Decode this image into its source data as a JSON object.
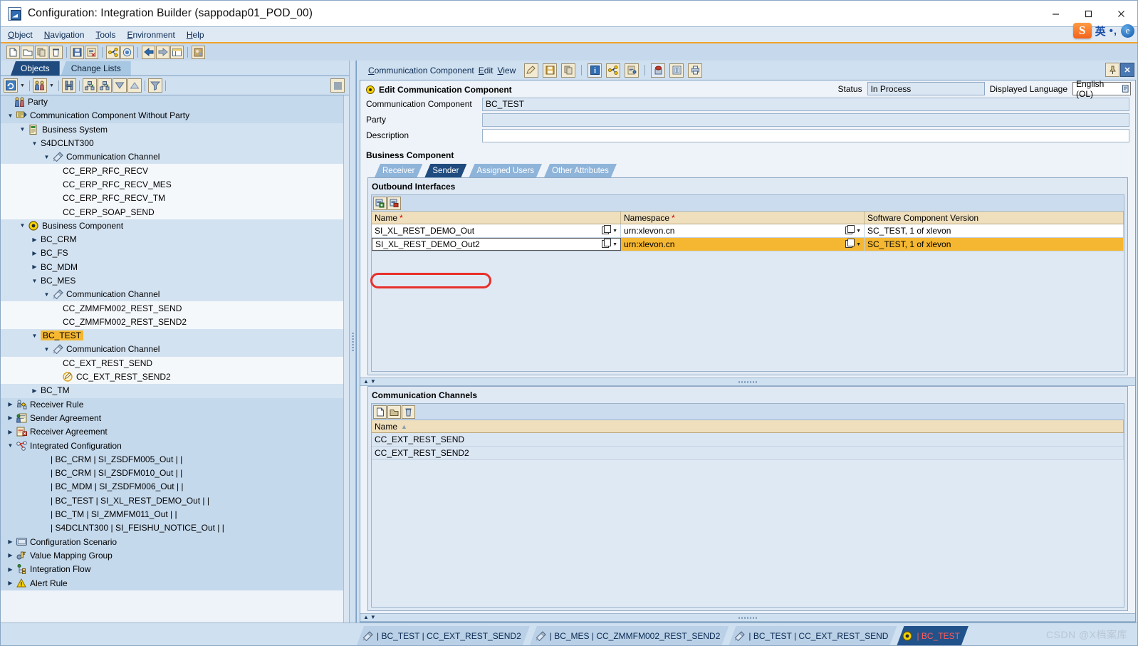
{
  "window": {
    "title": "Configuration: Integration Builder (sappodap01_POD_00)",
    "app_icon": "integration-builder-icon",
    "minimize": "—",
    "maximize": "☐",
    "close": "✕"
  },
  "menubar": {
    "items": [
      {
        "label": "Object",
        "accel": "O"
      },
      {
        "label": "Navigation",
        "accel": "N"
      },
      {
        "label": "Tools",
        "accel": "T"
      },
      {
        "label": "Environment",
        "accel": "E"
      },
      {
        "label": "Help",
        "accel": "H"
      }
    ]
  },
  "ime": {
    "logo": "S",
    "mode": "英",
    "punct": "•,",
    "browser": "e"
  },
  "app_toolbar": {
    "buttons": [
      "new-icon",
      "open-icon",
      "copy-icon",
      "delete-icon",
      "save-icon",
      "activate-icon",
      "where-used-icon",
      "check-icon",
      "back-icon",
      "forward-icon",
      "list-icon",
      "theme-icon"
    ]
  },
  "left_pane": {
    "tabs": [
      {
        "label": "Objects",
        "active": true
      },
      {
        "label": "Change Lists",
        "active": false
      }
    ],
    "toolbar_buttons": [
      "refresh-icon",
      "refresh-dropdown-icon",
      "find-objects-icon",
      "find-objects-dropdown-icon",
      "search-icon",
      "expand-all-icon",
      "collapse-all-icon",
      "move-down-icon",
      "move-up-icon",
      "filter-icon",
      "stop-icon"
    ],
    "tree": [
      {
        "depth": 0,
        "label": "Party",
        "icon": "party-icon",
        "arrow": "none",
        "band": 0
      },
      {
        "depth": 0,
        "label": "Communication Component Without Party",
        "icon": "comm-component-noparty-icon",
        "arrow": "down",
        "band": 0
      },
      {
        "depth": 1,
        "label": "Business System",
        "icon": "business-system-icon",
        "arrow": "down",
        "band": 1
      },
      {
        "depth": 2,
        "label": "S4DCLNT300",
        "icon": "none",
        "arrow": "down",
        "band": 1
      },
      {
        "depth": 3,
        "label": "Communication Channel",
        "icon": "comm-channel-icon",
        "arrow": "down",
        "band": 1
      },
      {
        "depth": 4,
        "label": "CC_ERP_RFC_RECV",
        "icon": "none",
        "arrow": "none",
        "band": 3
      },
      {
        "depth": 4,
        "label": "CC_ERP_RFC_RECV_MES",
        "icon": "none",
        "arrow": "none",
        "band": 3
      },
      {
        "depth": 4,
        "label": "CC_ERP_RFC_RECV_TM",
        "icon": "none",
        "arrow": "none",
        "band": 3
      },
      {
        "depth": 4,
        "label": "CC_ERP_SOAP_SEND",
        "icon": "none",
        "arrow": "none",
        "band": 3
      },
      {
        "depth": 1,
        "label": "Business Component",
        "icon": "business-component-icon",
        "arrow": "down",
        "band": 1
      },
      {
        "depth": 2,
        "label": "BC_CRM",
        "icon": "none",
        "arrow": "right",
        "band": 1
      },
      {
        "depth": 2,
        "label": "BC_FS",
        "icon": "none",
        "arrow": "right",
        "band": 1
      },
      {
        "depth": 2,
        "label": "BC_MDM",
        "icon": "none",
        "arrow": "right",
        "band": 1
      },
      {
        "depth": 2,
        "label": "BC_MES",
        "icon": "none",
        "arrow": "down",
        "band": 1
      },
      {
        "depth": 3,
        "label": "Communication Channel",
        "icon": "comm-channel-icon",
        "arrow": "down",
        "band": 1
      },
      {
        "depth": 4,
        "label": "CC_ZMMFM002_REST_SEND",
        "icon": "none",
        "arrow": "none",
        "band": 3
      },
      {
        "depth": 4,
        "label": "CC_ZMMFM002_REST_SEND2",
        "icon": "none",
        "arrow": "none",
        "band": 3
      },
      {
        "depth": 2,
        "label": "BC_TEST",
        "icon": "none",
        "arrow": "down",
        "band": 1,
        "highlight": true
      },
      {
        "depth": 3,
        "label": "Communication Channel",
        "icon": "comm-channel-icon",
        "arrow": "down",
        "band": 1
      },
      {
        "depth": 4,
        "label": "CC_EXT_REST_SEND",
        "icon": "none",
        "arrow": "none",
        "band": 3
      },
      {
        "depth": 4,
        "label": "CC_EXT_REST_SEND2",
        "icon": "edit-object-icon",
        "arrow": "none",
        "band": 3
      },
      {
        "depth": 2,
        "label": "BC_TM",
        "icon": "none",
        "arrow": "right",
        "band": 1
      },
      {
        "depth": 0,
        "label": "Receiver Rule",
        "icon": "receiver-rule-icon",
        "arrow": "right",
        "band": 0
      },
      {
        "depth": 0,
        "label": "Sender Agreement",
        "icon": "sender-agreement-icon",
        "arrow": "right",
        "band": 0
      },
      {
        "depth": 0,
        "label": "Receiver Agreement",
        "icon": "receiver-agreement-icon",
        "arrow": "right",
        "band": 0
      },
      {
        "depth": 0,
        "label": "Integrated Configuration",
        "icon": "integrated-config-icon",
        "arrow": "down",
        "band": 0
      },
      {
        "depth": 3,
        "label": "| BC_CRM | SI_ZSDFM005_Out |  |",
        "icon": "none",
        "arrow": "none",
        "band": 0
      },
      {
        "depth": 3,
        "label": "| BC_CRM | SI_ZSDFM010_Out |  |",
        "icon": "none",
        "arrow": "none",
        "band": 0
      },
      {
        "depth": 3,
        "label": "| BC_MDM | SI_ZSDFM006_Out |  |",
        "icon": "none",
        "arrow": "none",
        "band": 0
      },
      {
        "depth": 3,
        "label": "| BC_TEST | SI_XL_REST_DEMO_Out |  |",
        "icon": "none",
        "arrow": "none",
        "band": 0
      },
      {
        "depth": 3,
        "label": "| BC_TM | SI_ZMMFM011_Out |  |",
        "icon": "none",
        "arrow": "none",
        "band": 0
      },
      {
        "depth": 3,
        "label": "| S4DCLNT300 | SI_FEISHU_NOTICE_Out |  |",
        "icon": "none",
        "arrow": "none",
        "band": 0
      },
      {
        "depth": 0,
        "label": "Configuration Scenario",
        "icon": "config-scenario-icon",
        "arrow": "right",
        "band": 0
      },
      {
        "depth": 0,
        "label": "Value Mapping Group",
        "icon": "value-mapping-icon",
        "arrow": "right",
        "band": 0
      },
      {
        "depth": 0,
        "label": "Integration Flow",
        "icon": "integration-flow-icon",
        "arrow": "right",
        "band": 0
      },
      {
        "depth": 0,
        "label": "Alert Rule",
        "icon": "alert-rule-icon",
        "arrow": "right",
        "band": 0
      }
    ]
  },
  "editor": {
    "menu": [
      {
        "label": "Communication Component",
        "accel": "C"
      },
      {
        "label": "Edit",
        "accel": "E"
      },
      {
        "label": "View",
        "accel": "V"
      }
    ],
    "toolbar_buttons": [
      "edit-mode-icon",
      "save-icon",
      "copy-icon",
      "info-icon",
      "where-used-icon",
      "change-list-icon",
      "history-icon",
      "docs-icon",
      "print-icon"
    ],
    "right_buttons": [
      "pin-icon",
      "close-window-icon"
    ],
    "header": {
      "title": "Edit Communication Component",
      "status_label": "Status",
      "status_value": "In Process",
      "language_label": "Displayed Language",
      "language_value": "English (OL)"
    },
    "fields": [
      {
        "label": "Communication Component",
        "value": "BC_TEST",
        "readonly": true
      },
      {
        "label": "Party",
        "value": "",
        "readonly": true
      },
      {
        "label": "Description",
        "value": "",
        "readonly": false
      }
    ],
    "section_title": "Business Component",
    "tabs": [
      {
        "label": "Receiver",
        "active": false
      },
      {
        "label": "Sender",
        "active": true
      },
      {
        "label": "Assigned Users",
        "active": false
      },
      {
        "label": "Other Attributes",
        "active": false
      }
    ],
    "outbound": {
      "title": "Outbound Interfaces",
      "toolbar_buttons": [
        "insert-row-icon",
        "delete-row-icon"
      ],
      "columns": [
        {
          "label": "Name",
          "required": true
        },
        {
          "label": "Namespace",
          "required": true
        },
        {
          "label": "Software Component Version",
          "required": false
        }
      ],
      "rows": [
        {
          "name": "SI_XL_REST_DEMO_Out",
          "namespace": "urn:xlevon.cn",
          "scv": "SC_TEST, 1 of xlevon",
          "selected": false
        },
        {
          "name": "SI_XL_REST_DEMO_Out2",
          "namespace": "urn:xlevon.cn",
          "scv": "SC_TEST, 1 of xlevon",
          "selected": true
        }
      ]
    },
    "channels": {
      "title": "Communication Channels",
      "toolbar_buttons": [
        "new-channel-icon",
        "open-channel-icon",
        "delete-channel-icon"
      ],
      "columns": [
        {
          "label": "Name",
          "sort": "ascending"
        }
      ],
      "rows": [
        {
          "name": "CC_EXT_REST_SEND"
        },
        {
          "name": "CC_EXT_REST_SEND2"
        }
      ]
    }
  },
  "taskbar": {
    "tabs": [
      {
        "label": "| BC_TEST | CC_EXT_REST_SEND2",
        "icon": "comm-channel-icon",
        "active": false
      },
      {
        "label": "| BC_MES | CC_ZMMFM002_REST_SEND2",
        "icon": "comm-channel-icon",
        "active": false
      },
      {
        "label": "| BC_TEST | CC_EXT_REST_SEND",
        "icon": "comm-channel-icon",
        "active": false
      },
      {
        "label": "| BC_TEST",
        "icon": "business-component-icon",
        "active": true
      }
    ]
  },
  "watermark": "CSDN @X档案库",
  "colors": {
    "accent_blue": "#1f4b7e",
    "selection_orange": "#f5b731",
    "annotation_red": "#e8302a",
    "panel_blue": "#cfe0f0",
    "header_tan": "#efdfbd"
  }
}
